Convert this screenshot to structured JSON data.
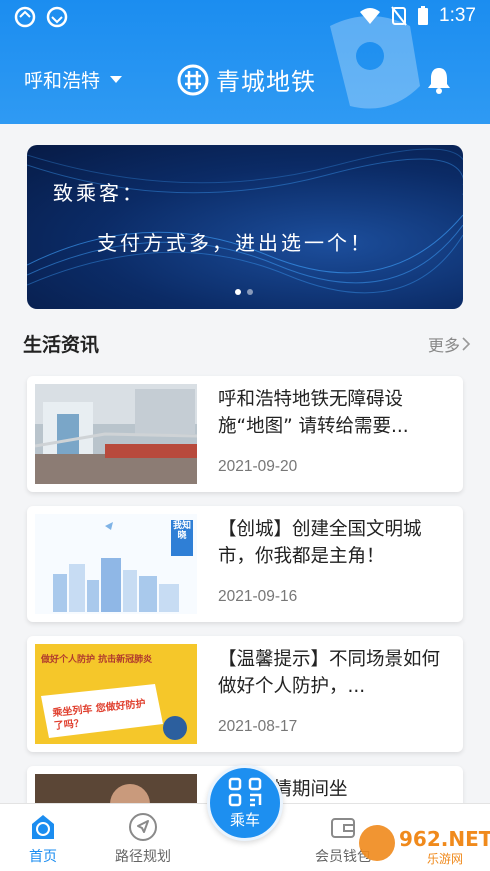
{
  "status_bar": {
    "time": "1:37"
  },
  "header": {
    "city": "呼和浩特",
    "brand": "青城地铁"
  },
  "banner": {
    "line1": "致乘客：",
    "line2": "支付方式多，进出选一个！",
    "slides": 2,
    "active_slide": 0
  },
  "section": {
    "title": "生活资讯",
    "more_label": "更多"
  },
  "news": [
    {
      "title": "呼和浩特地铁无障碍设施“地图” 请转给需要...",
      "date": "2021-09-20"
    },
    {
      "title": "【创城】创建全国文明城市，你我都是主角！",
      "date": "2021-09-16"
    },
    {
      "title": "【温馨提示】不同场景如何做好个人防护，...",
      "date": "2021-08-17"
    },
    {
      "title": "全绍疫情期间坐",
      "date": ""
    }
  ],
  "thumbs": {
    "news2_badge": "我知晓",
    "news3_top": "做好个人防护 抗击新冠肺炎",
    "news3_sign": "乘坐列车 您做好防护了吗？"
  },
  "bottom_nav": {
    "home": "首页",
    "route": "路径规划",
    "ride": "乘车",
    "wallet": "会员钱包"
  },
  "watermark": {
    "text": "962.NET",
    "sub": "乐游网"
  },
  "colors": {
    "primary": "#1b8df0",
    "banner_bg": "#0b2b66",
    "accent_yellow": "#f5c72a"
  }
}
